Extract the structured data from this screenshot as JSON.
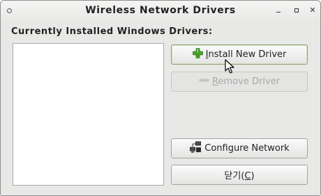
{
  "window": {
    "title": "Wireless Network Drivers"
  },
  "section_label": "Currently Installed Windows Drivers:",
  "driver_list": [],
  "buttons": {
    "install": {
      "mnemonic": "I",
      "rest": "nstall New Driver",
      "icon": "green-plus-icon",
      "state": "focused"
    },
    "remove": {
      "mnemonic": "R",
      "rest": "emove Driver",
      "icon": "minus-icon",
      "state": "disabled"
    },
    "configure": {
      "label": "Configure Network",
      "icon": "network-icon"
    },
    "close": {
      "prefix": "닫기(",
      "mnemonic": "C",
      "suffix": ")"
    }
  },
  "colors": {
    "window_bg": "#e8e8e7",
    "plus_green": "#4aa02c",
    "focus_border": "#8aa26a"
  }
}
